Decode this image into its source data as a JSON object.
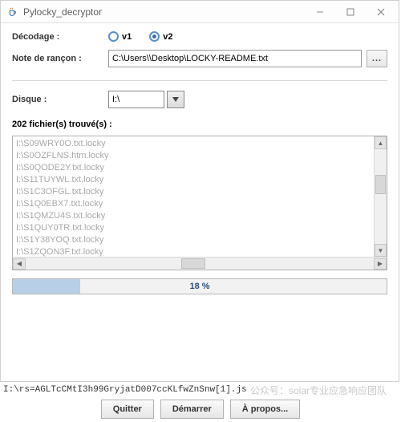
{
  "window": {
    "title": "Pylocky_decryptor"
  },
  "labels": {
    "decodage": "Décodage :",
    "note": "Note de rançon :",
    "disque": "Disque :",
    "found": "202 fichier(s) trouvé(s) :"
  },
  "radios": {
    "v1": "v1",
    "v2": "v2",
    "selected": "v2"
  },
  "note_path": "C:\\Users\\\\Desktop\\LOCKY-README.txt",
  "browse_label": "...",
  "disk_selected": "I:\\",
  "files": [
    "I:\\S09WRY0O.txt.locky",
    "I:\\S0OZFLNS.htm.locky",
    "I:\\S0QODE2Y.txt.locky",
    "I:\\S11TUYWL.txt.locky",
    "I:\\S1C3OFGL.txt.locky",
    "I:\\S1Q0EBX7.txt.locky",
    "I:\\S1QMZU4S.txt.locky",
    "I:\\S1QUY0TR.txt.locky",
    "I:\\S1Y38YOQ.txt.locky",
    "I:\\S1ZQON3F.txt.locky"
  ],
  "progress": {
    "percent": 18,
    "text": "18 %"
  },
  "status_line": "I:\\rs=AGLTcCMtI3h99GryjatD007ccKLfwZnSnw[1].js",
  "buttons": {
    "quitter": "Quitter",
    "demarrer": "Démarrer",
    "apropos": "À propos..."
  },
  "watermark": "公众号：solar专业应急响应团队"
}
